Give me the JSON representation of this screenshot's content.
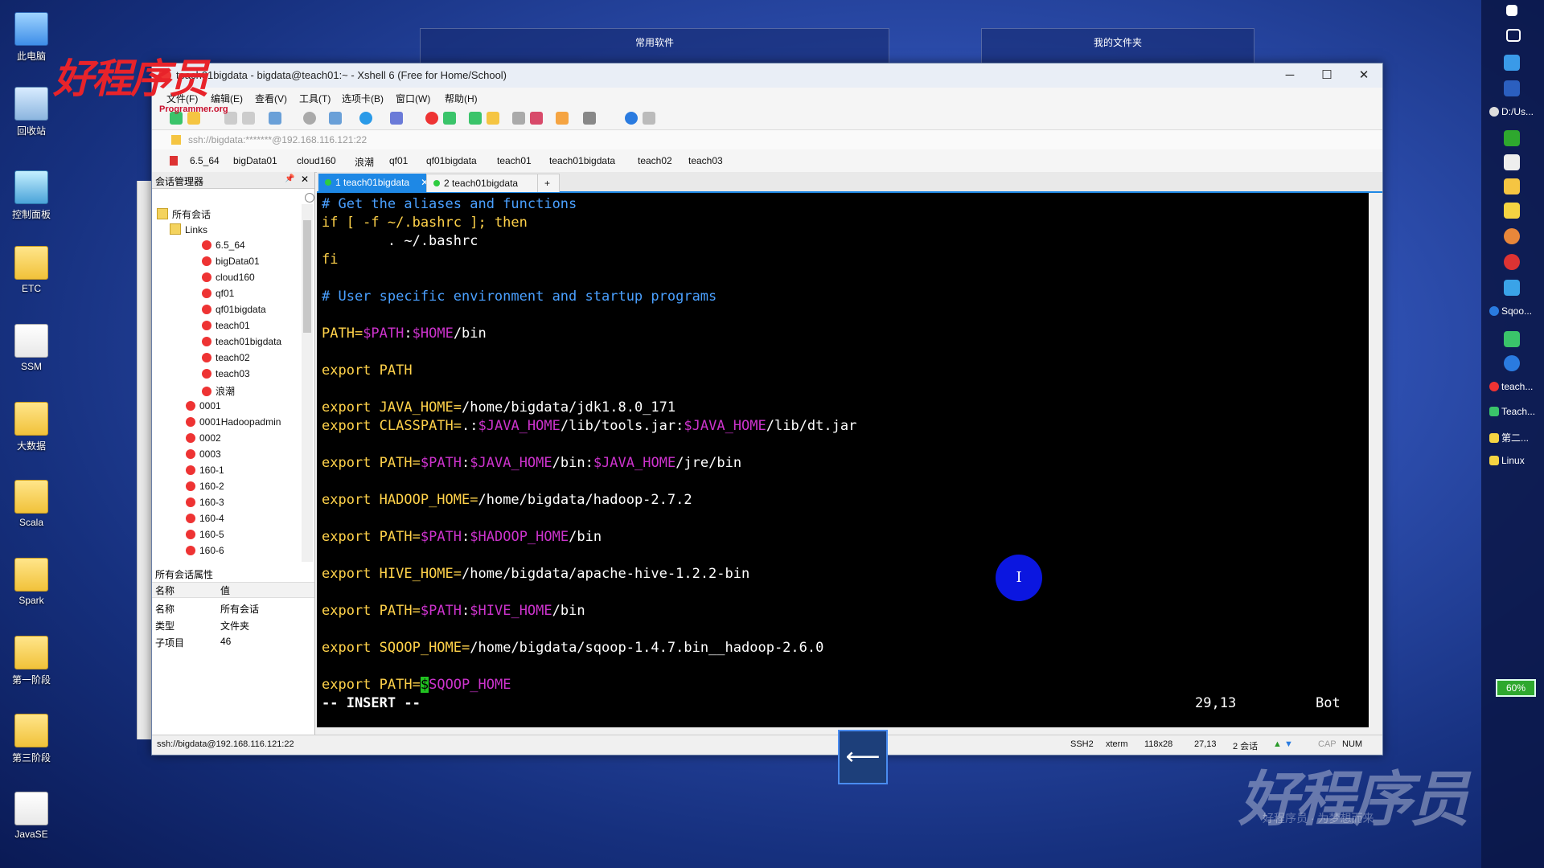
{
  "desktop": {
    "icons": [
      {
        "label": "此电脑"
      },
      {
        "label": "回收站"
      },
      {
        "label": "控制面板"
      },
      {
        "label": "ETC"
      },
      {
        "label": "SSM"
      },
      {
        "label": "大数据"
      },
      {
        "label": "Scala"
      },
      {
        "label": "Spark"
      },
      {
        "label": "第一阶段"
      },
      {
        "label": "第三阶段"
      },
      {
        "label": "JavaSE"
      }
    ],
    "widgets": [
      "常用软件",
      "我的文件夹"
    ],
    "watermark_top": "好程序员",
    "watermark_top_sub": "Programmer.org",
    "watermark_bottom": "好程序员",
    "watermark_bottom_sub": "好程序员 · 为梦想而来"
  },
  "taskbar": {
    "items": [
      "D:/Us...",
      "Sqoo...",
      "teach...",
      "Teach...",
      "第二...",
      "Linux"
    ],
    "battery": "60%"
  },
  "window": {
    "title": "teach01bigdata - bigdata@teach01:~ - Xshell 6 (Free for Home/School)",
    "controls": {
      "minimize": "─",
      "maximize": "☐",
      "close": "✕"
    },
    "menu": [
      "文件(F)",
      "编辑(E)",
      "查看(V)",
      "工具(T)",
      "选项卡(B)",
      "窗口(W)",
      "帮助(H)"
    ],
    "address": "ssh://bigdata:*******@192.168.116.121:22",
    "links": [
      "6.5_64",
      "bigData01",
      "cloud160",
      "浪潮",
      "qf01",
      "qf01bigdata",
      "teach01",
      "teach01bigdata",
      "teach02",
      "teach03"
    ]
  },
  "session_manager": {
    "title": "会话管理器",
    "pin": "📌",
    "close": "✕",
    "root": "所有会话",
    "links_folder": "Links",
    "links_items": [
      "6.5_64",
      "bigData01",
      "cloud160",
      "qf01",
      "qf01bigdata",
      "teach01",
      "teach01bigdata",
      "teach02",
      "teach03",
      "浪潮"
    ],
    "root_items": [
      "0001",
      "0001Hadoopadmin",
      "0002",
      "0003",
      "160-1",
      "160-2",
      "160-3",
      "160-4",
      "160-5",
      "160-6"
    ],
    "props_title": "所有会话属性",
    "props_header": {
      "name": "名称",
      "value": "值"
    },
    "props": [
      {
        "k": "名称",
        "v": "所有会话"
      },
      {
        "k": "类型",
        "v": "文件夹"
      },
      {
        "k": "子项目",
        "v": "46"
      }
    ]
  },
  "tabs": [
    {
      "label": "1 teach01bigdata",
      "active": true
    },
    {
      "label": "2 teach01bigdata",
      "active": false
    }
  ],
  "tab_add": "+",
  "terminal": {
    "l1": "# Get the aliases and functions",
    "l2a": "if [ -f ~/.bashrc ]; ",
    "l2b": "then",
    "l3": "        . ~/.bashrc",
    "l4": "fi",
    "l5": "# User specific environment and startup programs",
    "l6a": "PATH=",
    "l6b": "$PATH",
    "l6c": ":",
    "l6d": "$HOME",
    "l6e": "/bin",
    "l7a": "export ",
    "l7b": "PATH",
    "l8a": "export ",
    "l8b": "JAVA_HOME=",
    "l8c": "/home/bigdata/jdk1.8.0_171",
    "l9a": "export ",
    "l9b": "CLASSPATH=",
    "l9c": ".:",
    "l9d": "$JAVA_HOME",
    "l9e": "/lib/tools.jar:",
    "l9f": "$JAVA_HOME",
    "l9g": "/lib/dt.jar",
    "l10a": "export ",
    "l10b": "PATH=",
    "l10c": "$PATH",
    "l10d": ":",
    "l10e": "$JAVA_HOME",
    "l10f": "/bin:",
    "l10g": "$JAVA_HOME",
    "l10h": "/jre/bin",
    "l11a": "export ",
    "l11b": "HADOOP_HOME=",
    "l11c": "/home/bigdata/hadoop-2.7.2",
    "l12a": "export ",
    "l12b": "PATH=",
    "l12c": "$PATH",
    "l12d": ":",
    "l12e": "$HADOOP_HOME",
    "l12f": "/bin",
    "l13a": "export ",
    "l13b": "HIVE_HOME=",
    "l13c": "/home/bigdata/apache-hive-1.2.2-bin",
    "l14a": "export ",
    "l14b": "PATH=",
    "l14c": "$PATH",
    "l14d": ":",
    "l14e": "$HIVE_HOME",
    "l14f": "/bin",
    "l15a": "export ",
    "l15b": "SQOOP_HOME=",
    "l15c": "/home/bigdata/sqoop-1.4.7.bin__hadoop-2.6.0",
    "l16a": "export ",
    "l16b": "PATH=",
    "l16cursor": "$",
    "l16d": "SQOOP_HOME",
    "mode": "-- INSERT --",
    "position": "29,13",
    "scroll": "Bot"
  },
  "statusbar": {
    "address": "ssh://bigdata@192.168.116.121:22",
    "protocol": "SSH2",
    "term": "xterm",
    "size": "118x28",
    "cursor": "27,13",
    "sessions": "2 会话",
    "caps": "CAP",
    "num": "NUM"
  },
  "overlay": {
    "ibeam": "I",
    "back_arrow": "⟵"
  }
}
